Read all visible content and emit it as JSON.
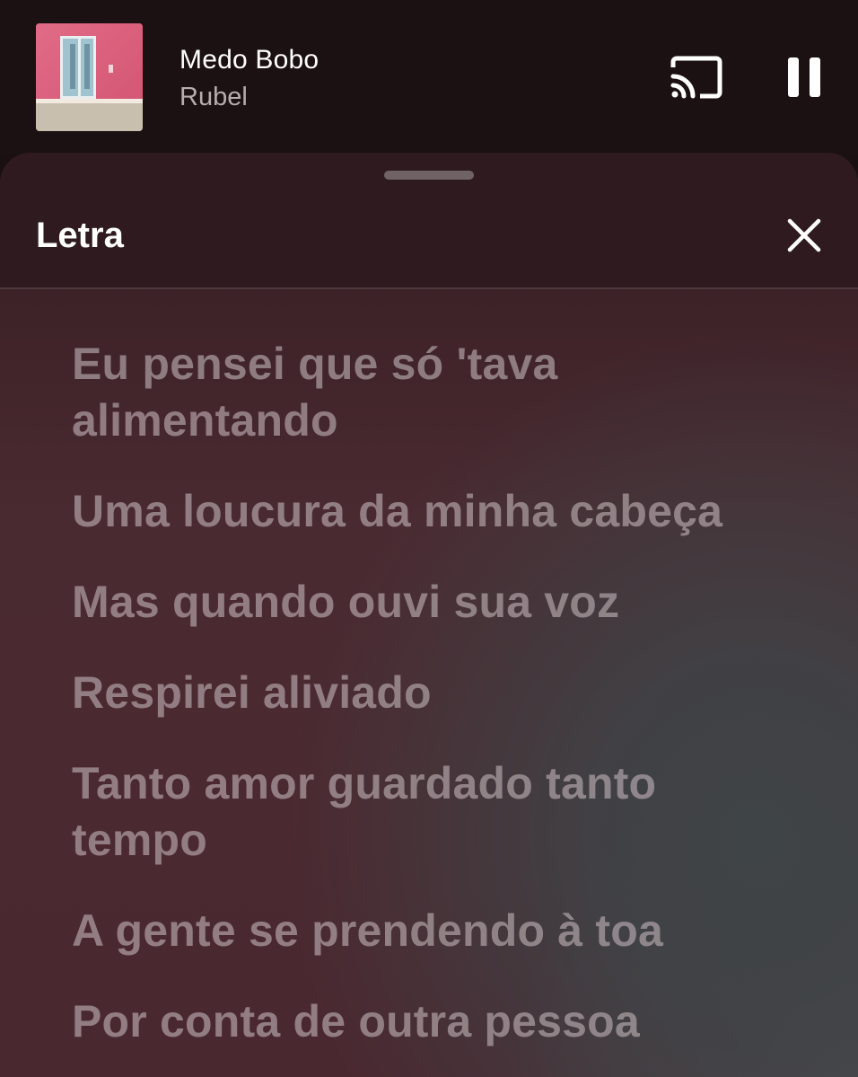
{
  "now_playing": {
    "title": "Medo Bobo",
    "artist": "Rubel",
    "cast_icon": "cast-icon",
    "pause_icon": "pause-icon"
  },
  "lyrics_sheet": {
    "title": "Letra",
    "close_icon": "close-icon",
    "lines": [
      "Eu pensei que só 'tava alimentando",
      "Uma loucura da minha cabeça",
      "Mas quando ouvi sua voz",
      "Respirei aliviado",
      "Tanto amor guardado tanto tempo",
      "A gente se prendendo à toa",
      "Por conta de outra pessoa"
    ]
  },
  "colors": {
    "mini_player_bg": "#1b1012",
    "sheet_header_bg": "#2f1b1f",
    "sheet_bg_accent": "#4a2a31",
    "lyric_text": "#b8acae"
  }
}
